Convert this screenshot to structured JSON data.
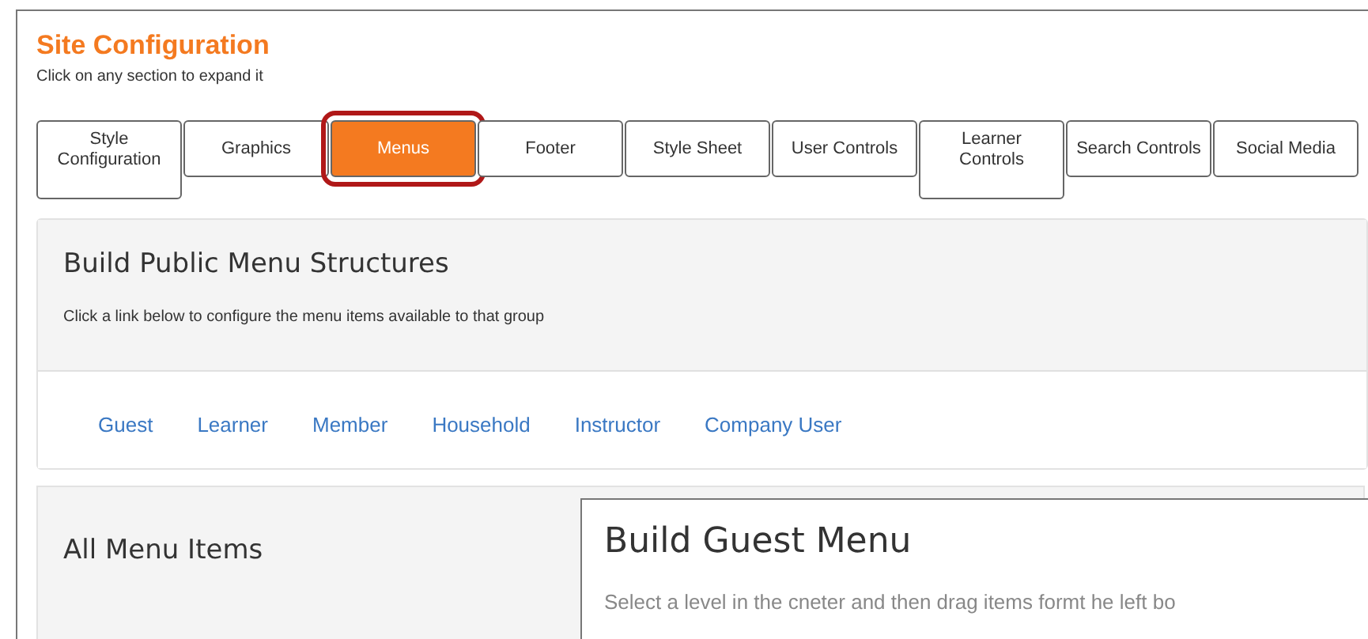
{
  "header": {
    "title": "Site Configuration",
    "subtitle": "Click on any section to expand it"
  },
  "tabs": [
    {
      "label": "Style\nConfiguration",
      "selected": false
    },
    {
      "label": "Graphics",
      "selected": false
    },
    {
      "label": "Menus",
      "selected": true
    },
    {
      "label": "Footer",
      "selected": false
    },
    {
      "label": "Style Sheet",
      "selected": false
    },
    {
      "label": "User Controls",
      "selected": false
    },
    {
      "label": "Learner\nControls",
      "selected": false
    },
    {
      "label": "Search Controls",
      "selected": false
    },
    {
      "label": "Social Media",
      "selected": false
    }
  ],
  "public_menu": {
    "title": "Build Public Menu Structures",
    "description": "Click a link below to configure the menu items available to that group",
    "links": [
      "Guest",
      "Learner",
      "Member",
      "Household",
      "Instructor",
      "Company User"
    ]
  },
  "all_menu_items": {
    "title": "All Menu Items"
  },
  "dialog": {
    "title": "Build Guest Menu",
    "text": "Select a level in the cneter and then drag items formt he left bo"
  }
}
